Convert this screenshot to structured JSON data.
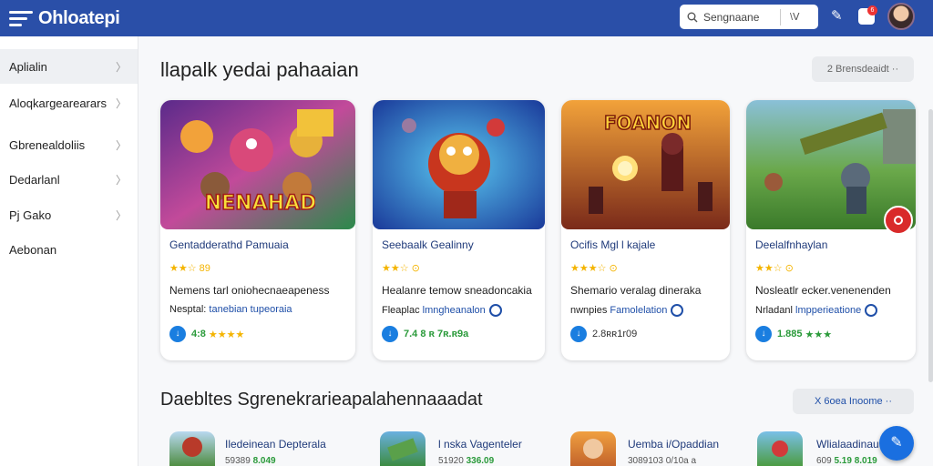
{
  "app": {
    "title": "Ohloatepi"
  },
  "topbar": {
    "search_placeholder": "Sengnaane",
    "search_ctrl": "\\ᐯ",
    "notif_count": "6"
  },
  "sidebar": {
    "items": [
      {
        "label": "Aplialin"
      },
      {
        "label": "Aloqkargearearars"
      },
      {
        "label": "Gbrenealdoliis"
      },
      {
        "label": "Dedarlanl"
      },
      {
        "label": "Pj Gako"
      },
      {
        "label": "Aebonan"
      }
    ]
  },
  "section1": {
    "title": "llapalk yedai pahaaian",
    "button": "2 Brensdeaidt ··"
  },
  "cards": [
    {
      "art": "NENAHAD",
      "title": "Gentadderathd Pamuaia",
      "rating": "★★☆ 89",
      "desc": "Nemens tarl oniohecnaeapeness",
      "desc2a": "Nesptal: ",
      "desc2b": "tanebian tupeoraia",
      "price": "4:8",
      "extra": "★★★★"
    },
    {
      "art": "",
      "title": "Seebaalk Gealinny",
      "rating": "★★☆ ⊙",
      "desc": "Healanre temow sneadoncakia",
      "desc2a": "Fleaplac ",
      "desc2b": "lmngheanalon",
      "price": "7.4 8 ʀ 7ʀ.ʀ9a",
      "extra": ""
    },
    {
      "art": "FOANON",
      "title": "Ocifis Mgl l kajale",
      "rating": "★★★☆ ⊙",
      "desc": "Shemario veralag dineraka",
      "desc2a": "nwnpies ",
      "desc2b": "Famolelation",
      "price": "2.8ʀʀ1r09",
      "extra": ""
    },
    {
      "art": "",
      "title": "Deelalfnhaylan",
      "rating": "★★☆ ⊙",
      "desc": "Nosleatlr ecker.venenenden",
      "desc2a": "Nrladanl ",
      "desc2b": "lmpperieatione",
      "price": "1.885",
      "extra": "★★★"
    }
  ],
  "section2": {
    "title": "Daebltes Sgrenekrarieapalahennaaadat",
    "button": "X 6oea Inoome ··"
  },
  "apps": [
    {
      "title": "Iledeinean Depterala",
      "sub": "59389 ",
      "price": "8.049"
    },
    {
      "title": "l nska Vagenteler",
      "sub": "51920 ",
      "price": "336.09"
    },
    {
      "title": "Uemba i/Opaddian",
      "sub": "3089103 0/10a a",
      "price": ""
    },
    {
      "title": "Wlialaadinau",
      "sub": "609 ",
      "price": "5.19 8.019"
    }
  ]
}
